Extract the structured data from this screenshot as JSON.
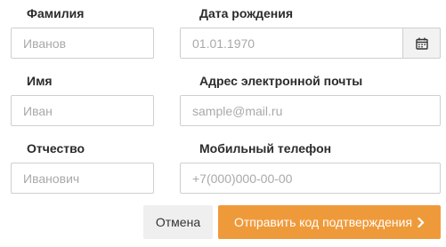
{
  "form": {
    "last_name": {
      "label": "Фамилия",
      "placeholder": "Иванов"
    },
    "birth_date": {
      "label": "Дата рождения",
      "placeholder": "01.01.1970",
      "icon": "calendar-icon"
    },
    "first_name": {
      "label": "Имя",
      "placeholder": "Иван"
    },
    "email": {
      "label": "Адрес электронной почты",
      "placeholder": "sample@mail.ru"
    },
    "patronymic": {
      "label": "Отчество",
      "placeholder": "Иванович"
    },
    "phone": {
      "label": "Мобильный телефон",
      "placeholder": "+7(000)000-00-00"
    }
  },
  "actions": {
    "cancel_label": "Отмена",
    "submit_label": "Отправить код подтверждения",
    "submit_icon": "chevron-right-icon",
    "submit_color": "#ef9a3a"
  }
}
